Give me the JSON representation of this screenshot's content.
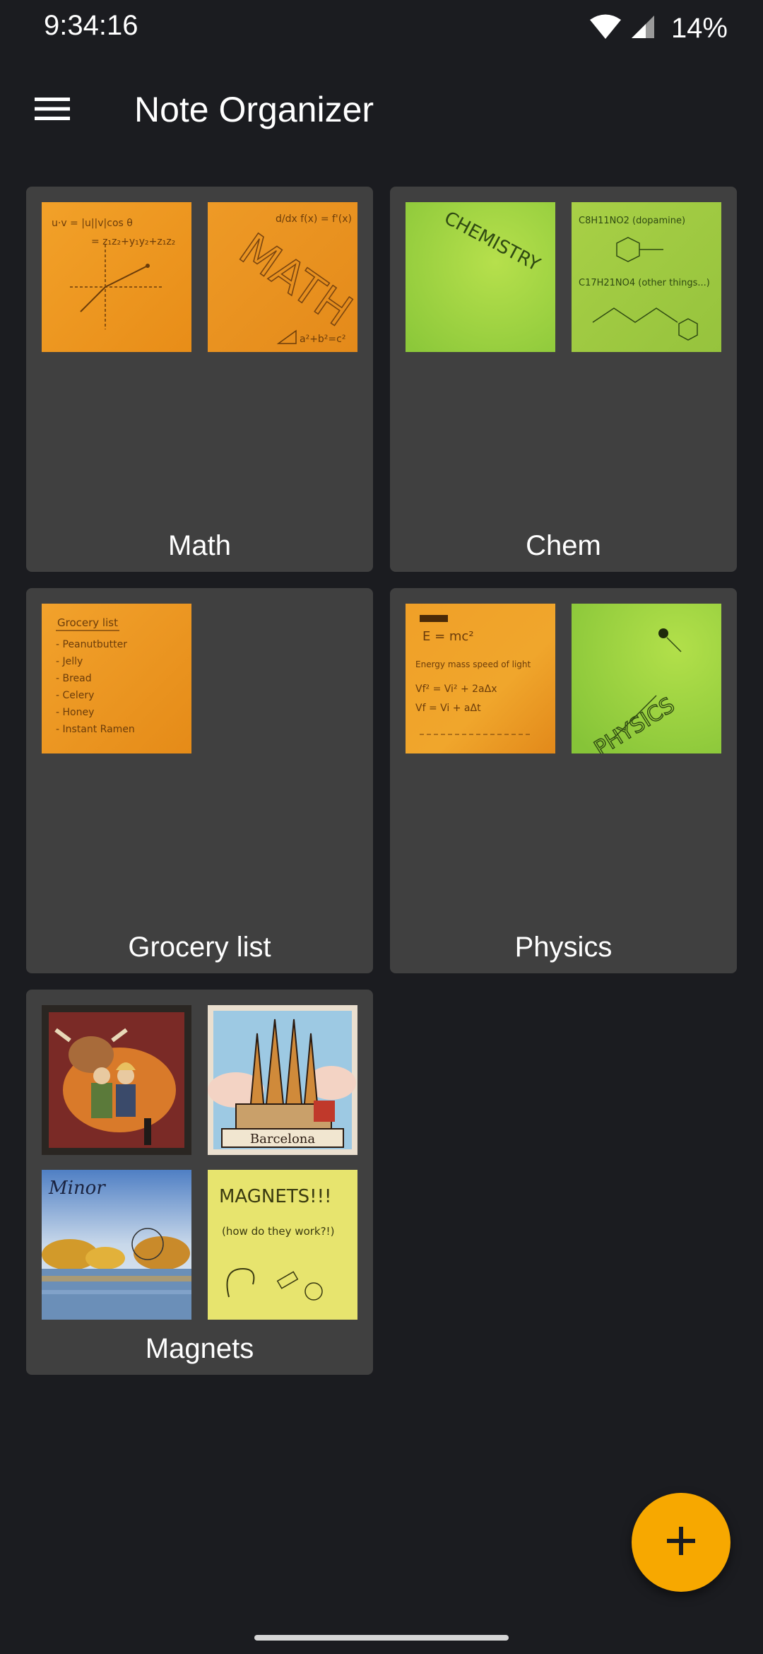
{
  "status_bar": {
    "time": "9:34:16",
    "battery": "14%",
    "icons": [
      "wifi-icon",
      "cell-signal-icon"
    ]
  },
  "app_bar": {
    "title": "Note Organizer",
    "menu_icon": "hamburger-menu-icon"
  },
  "folders": [
    {
      "label": "Math",
      "thumbnails": [
        "math-vector-note",
        "math-word-note"
      ]
    },
    {
      "label": "Chem",
      "thumbnails": [
        "chemistry-title-note",
        "chemistry-formula-note"
      ]
    },
    {
      "label": "Grocery list",
      "thumbnails": [
        "grocery-list-note"
      ]
    },
    {
      "label": "Physics",
      "thumbnails": [
        "physics-equations-note",
        "physics-title-note"
      ]
    },
    {
      "label": "Magnets",
      "thumbnails": [
        "cow-tile-magnet",
        "barcelona-magnet",
        "minor-watercolor-magnet",
        "magnets-note"
      ]
    }
  ],
  "thumbnail_text": {
    "math_word": "MATH",
    "math_vector": "u·v = |u||v|cos θ",
    "chem_title": "CHEMISTRY",
    "chem_formula_1": "C8H11NO2 (dopamine)",
    "chem_formula_2": "C17H21NO4 (other things...)",
    "grocery_lines": [
      "Grocery list",
      "- Peanutbutter",
      "- Jelly",
      "- Bread",
      "- Celery",
      "- Honey",
      "- Instant Ramen"
    ],
    "physics_eq": [
      "E = mc²",
      "Vf² = Vi² + 2aΔx",
      "Vf = Vi + aΔt"
    ],
    "physics_title": "PHYSICS",
    "barcelona": "Barcelona",
    "minor": "Minor",
    "magnets_title": "MAGNETS!!!",
    "magnets_sub": "(how do they work?!)"
  },
  "fab": {
    "icon": "plus-icon"
  },
  "colors": {
    "background": "#1b1c20",
    "card": "#404040",
    "accent": "#f7a800",
    "orange_note": "#f0961e",
    "green_note": "#a6d63c",
    "yellow_note": "#e6e36a"
  }
}
